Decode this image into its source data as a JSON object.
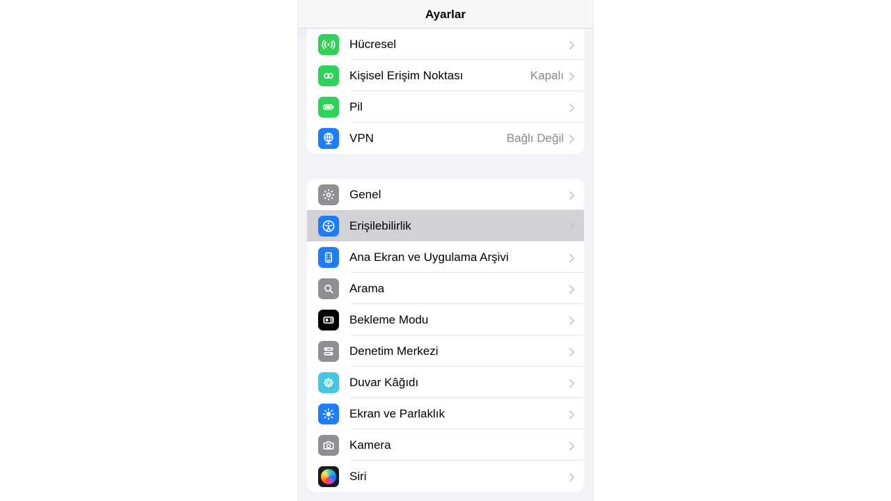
{
  "nav": {
    "title": "Ayarlar"
  },
  "group1": {
    "items": [
      {
        "label": "Hücresel",
        "value": ""
      },
      {
        "label": "Kişisel Erişim Noktası",
        "value": "Kapalı"
      },
      {
        "label": "Pil",
        "value": ""
      },
      {
        "label": "VPN",
        "value": "Bağlı Değil"
      }
    ]
  },
  "group2": {
    "items": [
      {
        "label": "Genel",
        "value": ""
      },
      {
        "label": "Erişilebilirlik",
        "value": ""
      },
      {
        "label": "Ana Ekran ve Uygulama Arşivi",
        "value": ""
      },
      {
        "label": "Arama",
        "value": ""
      },
      {
        "label": "Bekleme Modu",
        "value": ""
      },
      {
        "label": "Denetim Merkezi",
        "value": ""
      },
      {
        "label": "Duvar Kâğıdı",
        "value": ""
      },
      {
        "label": "Ekran ve Parlaklık",
        "value": ""
      },
      {
        "label": "Kamera",
        "value": ""
      },
      {
        "label": "Siri",
        "value": ""
      }
    ]
  },
  "selected_path": "group2.items.1"
}
